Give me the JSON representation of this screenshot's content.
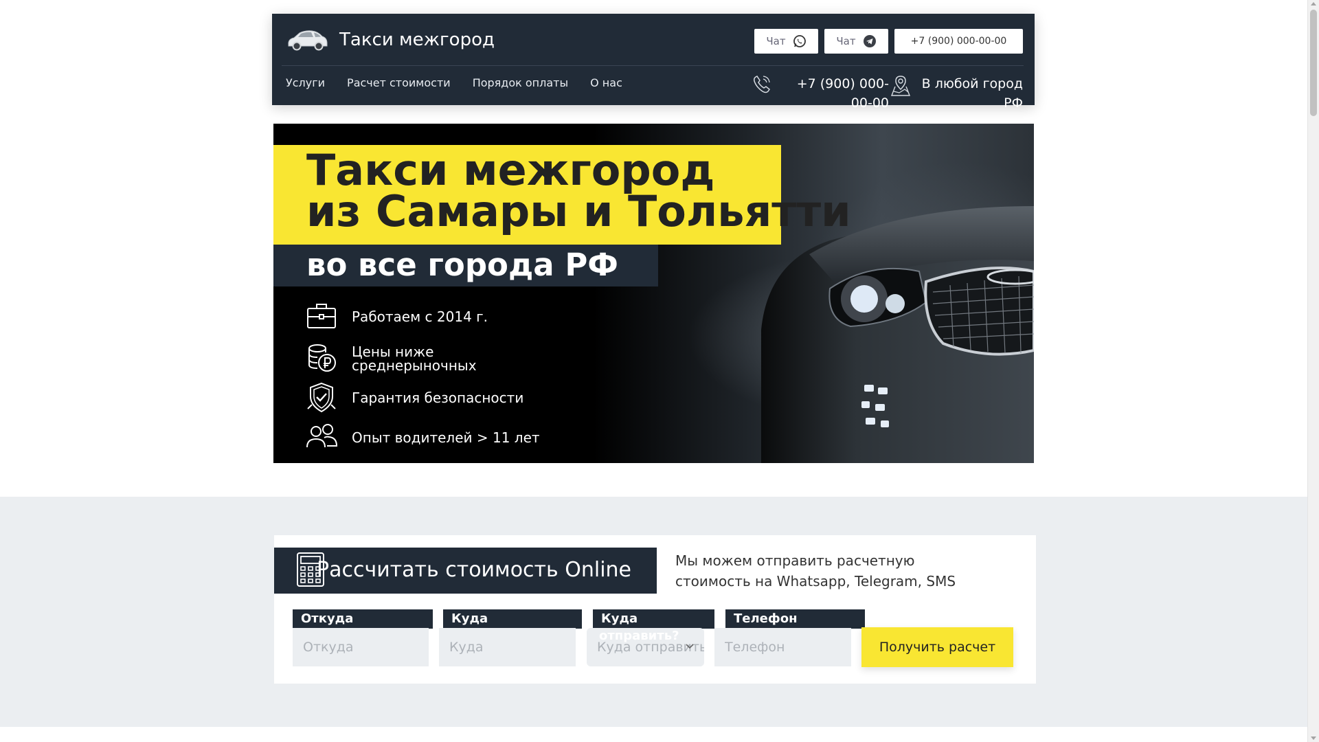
{
  "header": {
    "brand_title": "Такси межгород",
    "chat_whatsapp_label": "Чат",
    "chat_telegram_label": "Чат",
    "phone_button": "+7 (900) 000-00-00",
    "nav": [
      "Услуги",
      "Расчет стоимости",
      "Порядок оплаты",
      "О нас"
    ],
    "contact_phone": "+7 (900) 000-00-00",
    "contact_city": "В любой город РФ"
  },
  "hero": {
    "heading_line1": "Такси межгород",
    "heading_line2": "из Самары и Тольятти",
    "subheading": "во все города РФ",
    "features": [
      {
        "icon": "briefcase-icon",
        "label": "Работаем с 2014 г."
      },
      {
        "icon": "coins-ruble-icon",
        "label": "Цены ниже среднерыночных"
      },
      {
        "icon": "shield-check-icon",
        "label": "Гарантия безопасности"
      },
      {
        "icon": "users-icon",
        "label": "Опыт водителей > 11 лет"
      }
    ]
  },
  "calc": {
    "title": "Рассчитать стоимость Online",
    "description": "Мы можем отправить расчетную стоимость на Whatsapp, Telegram, SMS",
    "from_label": "Откуда",
    "from_placeholder": "Откуда",
    "to_label": "Куда",
    "to_placeholder": "Куда",
    "send_label": "Куда",
    "send_label_overflow": "отправить?",
    "send_select_value": "Куда отправить?",
    "phone_label": "Телефон",
    "phone_placeholder": "Телефон",
    "submit_label": "Получить расчет"
  },
  "colors": {
    "accent_yellow": "#f9e632",
    "dark_navy": "#212b37",
    "light_bg": "#ebeef1"
  }
}
